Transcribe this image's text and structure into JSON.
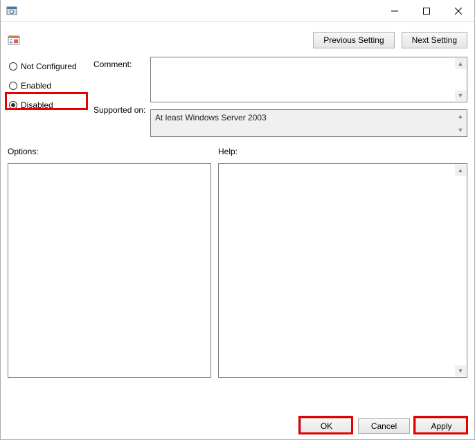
{
  "titlebar": {
    "title": ""
  },
  "nav": {
    "prev": "Previous Setting",
    "next": "Next Setting"
  },
  "radios": {
    "notconfigured": "Not Configured",
    "enabled": "Enabled",
    "disabled": "Disabled",
    "selected": "disabled"
  },
  "labels": {
    "comment": "Comment:",
    "supported": "Supported on:",
    "options": "Options:",
    "help": "Help:"
  },
  "fields": {
    "comment": "",
    "supported": "At least Windows Server 2003",
    "options": "",
    "help": ""
  },
  "footer": {
    "ok": "OK",
    "cancel": "Cancel",
    "apply": "Apply"
  }
}
